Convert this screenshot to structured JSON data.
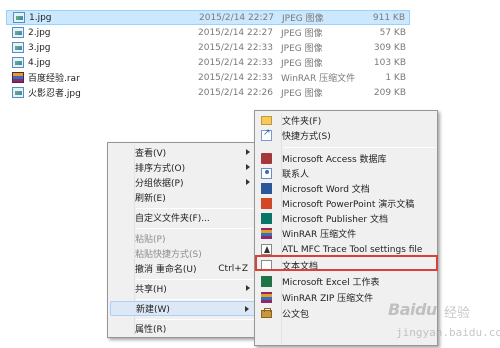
{
  "files": [
    {
      "name": "1.jpg",
      "date": "2015/2/14 22:27",
      "type": "JPEG 图像",
      "size": "911 KB",
      "icon": "jpg-icon"
    },
    {
      "name": "2.jpg",
      "date": "2015/2/14 22:27",
      "type": "JPEG 图像",
      "size": "57 KB",
      "icon": "jpg-icon"
    },
    {
      "name": "3.jpg",
      "date": "2015/2/14 22:33",
      "type": "JPEG 图像",
      "size": "309 KB",
      "icon": "jpg-icon"
    },
    {
      "name": "4.jpg",
      "date": "2015/2/14 22:33",
      "type": "JPEG 图像",
      "size": "103 KB",
      "icon": "jpg-icon"
    },
    {
      "name": "百度经验.rar",
      "date": "2015/2/14 22:33",
      "type": "WinRAR 压缩文件",
      "size": "1 KB",
      "icon": "rar-icon"
    },
    {
      "name": "火影忍者.jpg",
      "date": "2015/2/14 22:26",
      "type": "JPEG 图像",
      "size": "209 KB",
      "icon": "jpg-icon"
    }
  ],
  "context_menu": {
    "view": "查看(V)",
    "sort_by": "排序方式(O)",
    "group_by": "分组依据(P)",
    "refresh": "刷新(E)",
    "customize_folder": "自定义文件夹(F)...",
    "paste": "粘贴(P)",
    "paste_shortcut": "粘贴快捷方式(S)",
    "undo_rename": "撤消 重命名(U)",
    "undo_shortcut": "Ctrl+Z",
    "share_with": "共享(H)",
    "new": "新建(W)",
    "properties": "属性(R)"
  },
  "new_submenu": {
    "folder": "文件夹(F)",
    "shortcut": "快捷方式(S)",
    "access": "Microsoft Access 数据库",
    "contact": "联系人",
    "word": "Microsoft Word 文档",
    "powerpoint": "Microsoft PowerPoint 演示文稿",
    "publisher": "Microsoft Publisher 文档",
    "winrar": "WinRAR 压缩文件",
    "atl": "ATL MFC Trace Tool settings file",
    "text": "文本文档",
    "excel": "Microsoft Excel 工作表",
    "winrar_zip": "WinRAR ZIP 压缩文件",
    "briefcase": "公文包"
  },
  "watermark": {
    "logo": "Baidu",
    "sub": "经验",
    "url": "jingyan.baidu.com"
  },
  "colors": {
    "selection": "#cce8ff",
    "highlight_box": "#d8403a",
    "menu_bg": "#f0f0f0"
  }
}
